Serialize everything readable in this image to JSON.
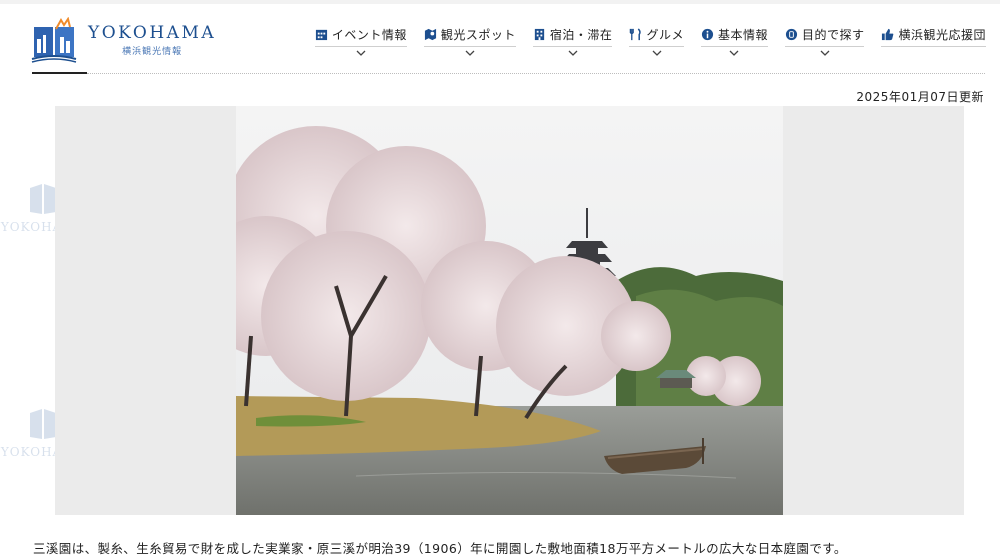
{
  "brand": {
    "title": "YOKOHAMA",
    "subtitle": "横浜観光情報"
  },
  "nav": {
    "items": [
      {
        "label": "イベント情報",
        "icon": "calendar-icon"
      },
      {
        "label": "観光スポット",
        "icon": "map-icon"
      },
      {
        "label": "宿泊・滞在",
        "icon": "hotel-icon"
      },
      {
        "label": "グルメ",
        "icon": "fork-knife-icon"
      },
      {
        "label": "基本情報",
        "icon": "info-icon"
      },
      {
        "label": "目的で探す",
        "icon": "search-badge-icon"
      },
      {
        "label": "横浜観光応援団",
        "icon": "thumbs-up-icon"
      }
    ]
  },
  "page": {
    "updated": "2025年01月07日更新",
    "caption": "三溪園は、製糸、生糸貿易で財を成した実業家・原三溪が明治39（1906）年に開園した敷地面積18万平方メートルの広大な日本庭園です。"
  },
  "colors": {
    "brand_blue": "#1d4f8f",
    "text": "#222222",
    "slide_bg": "#ebebeb"
  }
}
